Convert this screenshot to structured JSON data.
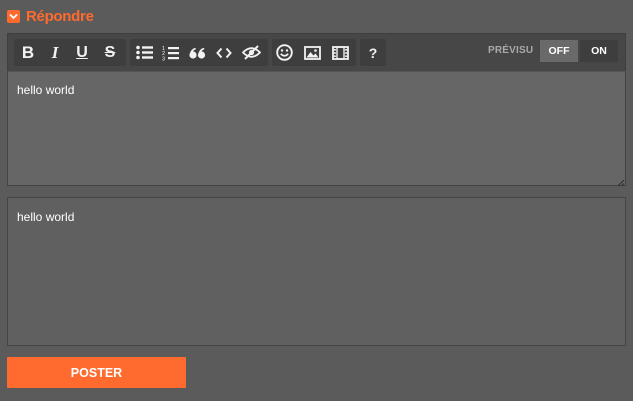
{
  "reply": {
    "title": "Répondre",
    "icon": "chevron-down-icon"
  },
  "toolbar": {
    "buttons": [
      {
        "name": "bold",
        "label": "B"
      },
      {
        "name": "italic",
        "label": "I"
      },
      {
        "name": "underline",
        "label": "U"
      },
      {
        "name": "strikethrough",
        "label": "S"
      },
      {
        "name": "bulleted-list",
        "icon": "bulleted-list-icon"
      },
      {
        "name": "numbered-list",
        "icon": "numbered-list-icon"
      },
      {
        "name": "quote",
        "label": "66"
      },
      {
        "name": "code",
        "label": "<>"
      },
      {
        "name": "spoiler",
        "icon": "eye-slash-icon"
      },
      {
        "name": "emoji",
        "icon": "smiley-icon"
      },
      {
        "name": "image",
        "icon": "image-icon"
      },
      {
        "name": "video",
        "icon": "film-icon"
      },
      {
        "name": "help",
        "label": "?"
      }
    ],
    "preview_label": "PRÉVISU",
    "toggle_off": "OFF",
    "toggle_on": "ON",
    "toggle_selected": "OFF"
  },
  "editor": {
    "value": "hello world"
  },
  "preview": {
    "text": "hello world"
  },
  "submit": {
    "label": "POSTER"
  },
  "colors": {
    "accent": "#ff6a2e",
    "background": "#5b5b5b",
    "toolbar": "#474747",
    "button_group": "#3e3e3e",
    "editor_bg": "#666666"
  }
}
